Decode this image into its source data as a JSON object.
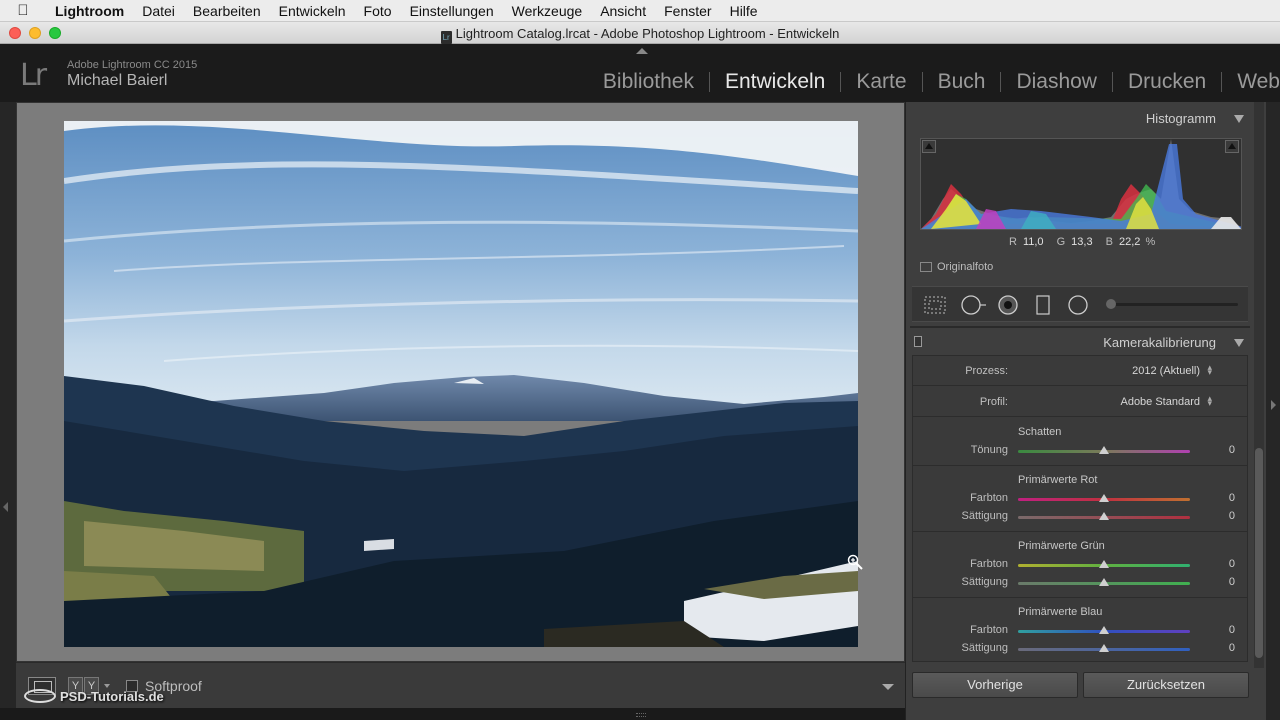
{
  "menubar": {
    "items": [
      "Lightroom",
      "Datei",
      "Bearbeiten",
      "Entwickeln",
      "Foto",
      "Einstellungen",
      "Werkzeuge",
      "Ansicht",
      "Fenster",
      "Hilfe"
    ]
  },
  "window": {
    "title": "Lightroom Catalog.lrcat - Adobe Photoshop Lightroom - Entwickeln"
  },
  "identity": {
    "logo": "Lr",
    "product": "Adobe Lightroom CC 2015",
    "user": "Michael Baierl"
  },
  "modules": [
    "Bibliothek",
    "Entwickeln",
    "Karte",
    "Buch",
    "Diashow",
    "Drucken",
    "Web"
  ],
  "active_module": "Entwickeln",
  "toolbar": {
    "y_label": "Y",
    "softproof": "Softproof"
  },
  "watermark": "PSD-Tutorials.de",
  "histogram": {
    "title": "Histogramm",
    "readout": {
      "r_label": "R",
      "r": "11,0",
      "g_label": "G",
      "g": "13,3",
      "b_label": "B",
      "b": "22,2",
      "unit": "%"
    },
    "original_label": "Originalfoto"
  },
  "calibration": {
    "title": "Kamerakalibrierung",
    "process_label": "Prozess:",
    "process_value": "2012 (Aktuell)",
    "profile_label": "Profil:",
    "profile_value": "Adobe Standard",
    "groups": [
      {
        "title": "Schatten",
        "sliders": [
          {
            "label": "Tönung",
            "value": "0"
          }
        ]
      },
      {
        "title": "Primärwerte Rot",
        "sliders": [
          {
            "label": "Farbton",
            "value": "0"
          },
          {
            "label": "Sättigung",
            "value": "0"
          }
        ]
      },
      {
        "title": "Primärwerte Grün",
        "sliders": [
          {
            "label": "Farbton",
            "value": "0"
          },
          {
            "label": "Sättigung",
            "value": "0"
          }
        ]
      },
      {
        "title": "Primärwerte Blau",
        "sliders": [
          {
            "label": "Farbton",
            "value": "0"
          },
          {
            "label": "Sättigung",
            "value": "0"
          }
        ]
      }
    ]
  },
  "buttons": {
    "previous": "Vorherige",
    "reset": "Zurücksetzen"
  },
  "colors": {
    "panel_bg": "#3e3e3e",
    "canvas_bg": "#7c7c7c",
    "active_module": "#e8e8e8"
  }
}
